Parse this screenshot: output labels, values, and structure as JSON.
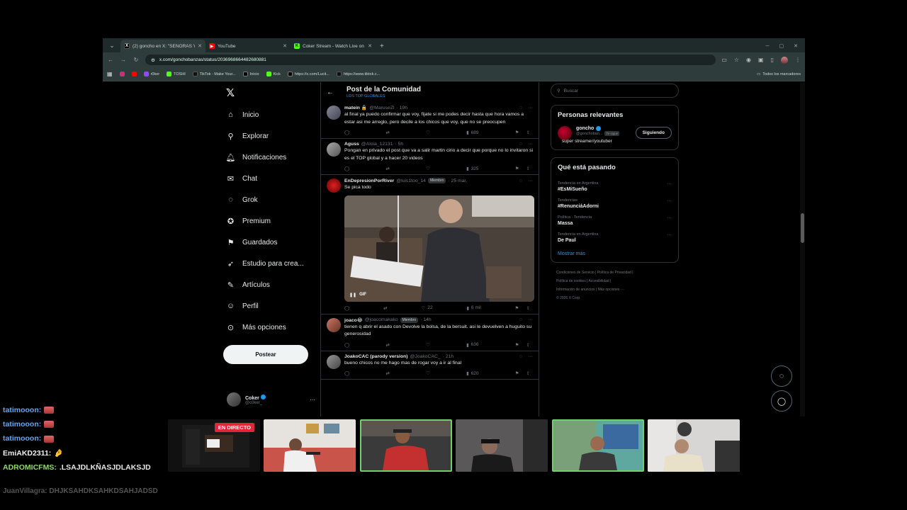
{
  "browser": {
    "tabs": [
      {
        "title": "(2) goncho en X: \"SEÑORAS Y",
        "color": "#000000",
        "glyph": "X",
        "active": true
      },
      {
        "title": "YouTube",
        "color": "#ff0000",
        "glyph": "▶",
        "active": false
      },
      {
        "title": "Coker Stream - Watch Live on",
        "color": "#53fc18",
        "glyph": "K",
        "active": false
      }
    ],
    "url": "x.com/gonchobanzas/status/2036968664482680881",
    "bookmarks": [
      "r0ker",
      "TOSHI",
      "TikTok - Make Your...",
      "Inicio",
      "Kick",
      "https://x.com/Lucit...",
      "https://www.tiktok.c..."
    ],
    "bookmarks_folder": "Todos los marcadores"
  },
  "nav": {
    "items": [
      "Inicio",
      "Explorar",
      "Notificaciones",
      "Chat",
      "Grok",
      "Premium",
      "Guardados",
      "Estudio para crea...",
      "Artículos",
      "Perfil",
      "Más opciones"
    ],
    "post_button": "Postear",
    "account": {
      "name": "Coker",
      "handle": "@c0ker_"
    }
  },
  "feed": {
    "title": "Post de la Comunidad",
    "subtitle": "LOS TOP GLOBALES",
    "tweets": [
      {
        "name": "matein 🔒",
        "handle": "@MaruseZl",
        "time": "· 19h",
        "badge": "",
        "text": "al final ya puedo confirmar que voy, fijate si me podes decir hasta que hora vamos a estar asi me arreglo, pero decile a los chicos que voy, que no se preocupen",
        "views": "689"
      },
      {
        "name": "Aguss",
        "handle": "@Aloia_12131",
        "time": "· 5h",
        "badge": "",
        "text": "Pongan en privado el post que va a salir martin cirio a decir que porque no lo invitaron si es el TOP global y a hacer 20 videos",
        "views": "325"
      },
      {
        "name": "EnDepresionPorRiver",
        "handle": "@luis1too_14",
        "time": "· 25 mar.",
        "badge": "Miembro",
        "text": "Se pica todo",
        "likes": "22",
        "views": "6 mil",
        "media_label": "GIF"
      },
      {
        "name": "joaco😂",
        "handle": "@joacomakako",
        "time": "· 14h",
        "badge": "Miembro",
        "text": "tienen q abrir el asado con Devolve la bolsa, de la bersuit. asi le devuelven a huguito su generosidad",
        "views": "636"
      },
      {
        "name": "JoakoCAC (parody version)",
        "handle": "@JoakoCAC_",
        "time": "· 21h",
        "badge": "",
        "text": "bueno chicos no me hago mas de rogar voy a ir al final",
        "views": "620"
      }
    ]
  },
  "right": {
    "search_placeholder": "Buscar",
    "relevant_title": "Personas relevantes",
    "person": {
      "name": "goncho",
      "handle": "@gonchoban...",
      "tag": "Te sigue",
      "bio": "super streamer/youtuber",
      "follow": "Siguiendo"
    },
    "trending_title": "Qué está pasando",
    "trends": [
      {
        "context": "Tendencia en Argentina",
        "name": "#EsMiSueño"
      },
      {
        "context": "Tendencias",
        "name": "#RenunciáAdorni"
      },
      {
        "context": "Política · Tendencia",
        "name": "Massa"
      },
      {
        "context": "Tendencia en Argentina",
        "name": "De Paul"
      }
    ],
    "more": "Mostrar más",
    "footer": [
      "Condiciones de Servicio",
      "Política de Privacidad",
      "Política de cookies",
      "Accesibilidad",
      "Información de anuncios",
      "Más opciones ···",
      "© 2026 X Corp."
    ]
  },
  "chat": {
    "lines": [
      {
        "user": "tatimooon:",
        "color": "#5aa9ff",
        "emote": true,
        "msg": ""
      },
      {
        "user": "tatimooon:",
        "color": "#5aa9ff",
        "emote": true,
        "msg": ""
      },
      {
        "user": "tatimooon:",
        "color": "#5aa9ff",
        "emote": true,
        "msg": ""
      },
      {
        "user": "EmiAKD2311:",
        "color": "#f0f0f0",
        "emote": false,
        "msg": "🤌"
      },
      {
        "user": "ADROMICFMS:",
        "color": "#8fd66f",
        "emote": false,
        "msg": ".LSAJDLKÑASJDLAKSJD"
      }
    ],
    "faded": "JuanVillagra: DHJKSAHDKSAHKDSAHJADSD"
  },
  "stream": {
    "live_label": "EN DIRECTO"
  }
}
